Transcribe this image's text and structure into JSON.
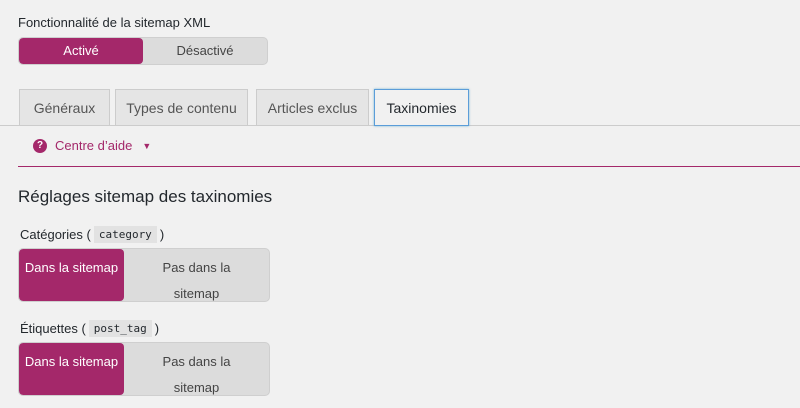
{
  "feature": {
    "label": "Fonctionnalité de la sitemap XML",
    "on_label": "Activé",
    "off_label": "Désactivé"
  },
  "tabs": [
    {
      "label": "Généraux"
    },
    {
      "label": "Types de contenu"
    },
    {
      "label": "Articles exclus"
    },
    {
      "label": "Taxinomies"
    }
  ],
  "help": {
    "label": "Centre d’aide"
  },
  "section": {
    "title": "Réglages sitemap des taxinomies"
  },
  "taxonomies": [
    {
      "label": "Catégories",
      "slug": "category",
      "on_label": "Dans la sitemap",
      "off_label": "Pas dans la sitemap"
    },
    {
      "label": "Étiquettes",
      "slug": "post_tag",
      "on_label": "Dans la sitemap",
      "off_label": "Pas dans la sitemap"
    }
  ],
  "colors": {
    "accent": "#a4286a",
    "focus": "#5b9dd9"
  }
}
